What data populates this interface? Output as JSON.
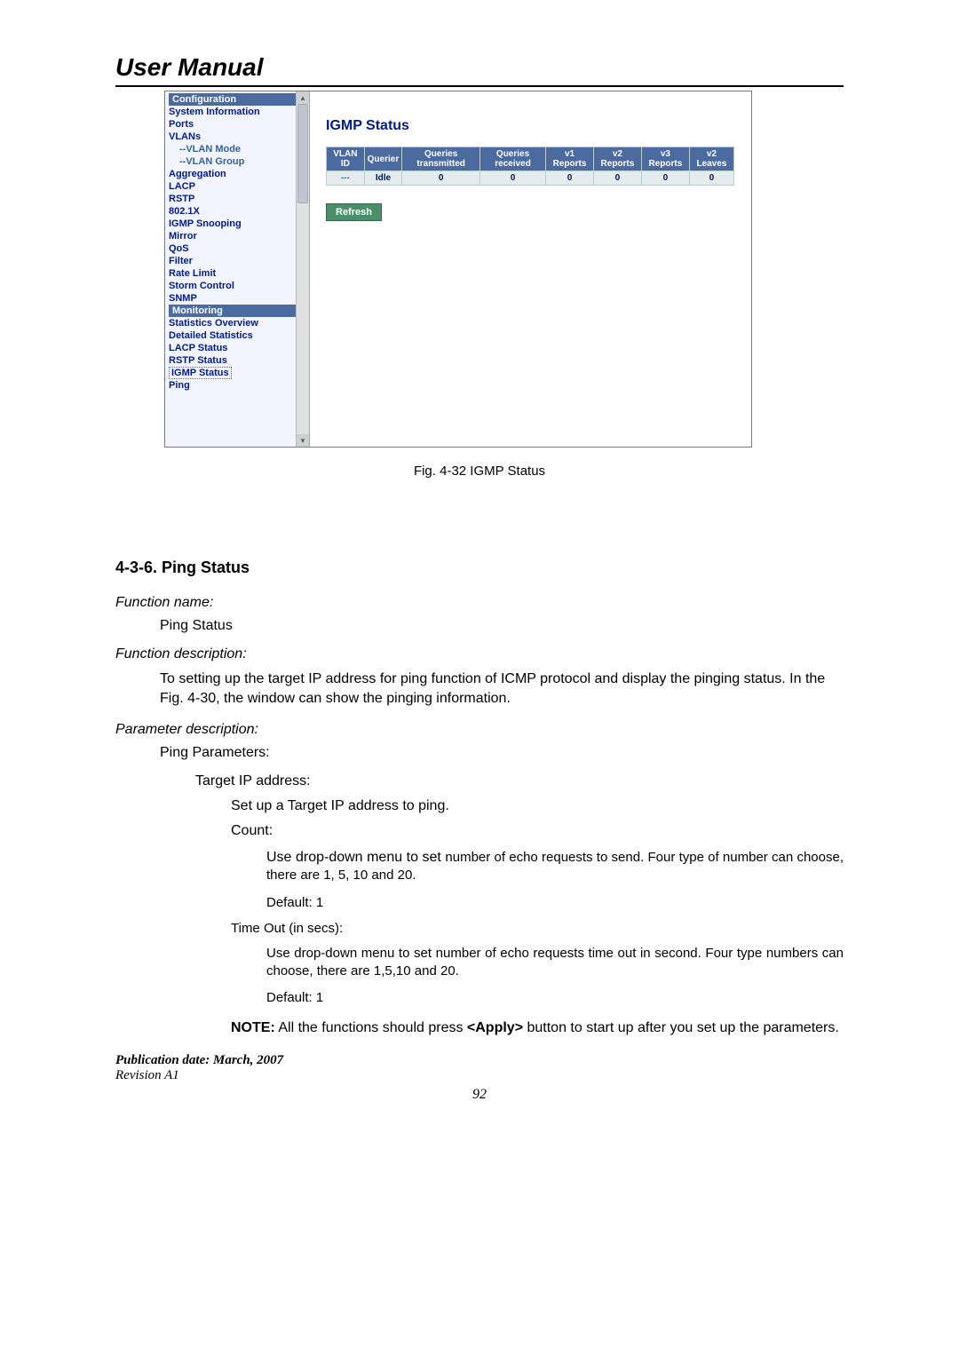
{
  "header": {
    "title": "User Manual"
  },
  "sidebar": {
    "sections": [
      {
        "type": "section",
        "label": "Configuration"
      },
      {
        "type": "item",
        "label": "System Information"
      },
      {
        "type": "item",
        "label": "Ports"
      },
      {
        "type": "item",
        "label": "VLANs"
      },
      {
        "type": "sub",
        "label": "--VLAN Mode"
      },
      {
        "type": "sub",
        "label": "--VLAN Group"
      },
      {
        "type": "item",
        "label": "Aggregation"
      },
      {
        "type": "item",
        "label": "LACP"
      },
      {
        "type": "item",
        "label": "RSTP"
      },
      {
        "type": "item",
        "label": "802.1X"
      },
      {
        "type": "item",
        "label": "IGMP Snooping"
      },
      {
        "type": "item",
        "label": "Mirror"
      },
      {
        "type": "item",
        "label": "QoS"
      },
      {
        "type": "item",
        "label": "Filter"
      },
      {
        "type": "item",
        "label": "Rate Limit"
      },
      {
        "type": "item",
        "label": "Storm Control"
      },
      {
        "type": "item",
        "label": "SNMP"
      },
      {
        "type": "section",
        "label": "Monitoring"
      },
      {
        "type": "item",
        "label": "Statistics Overview"
      },
      {
        "type": "item",
        "label": "Detailed Statistics"
      },
      {
        "type": "item",
        "label": "LACP Status"
      },
      {
        "type": "item",
        "label": "RSTP Status"
      },
      {
        "type": "item",
        "label": "IGMP Status",
        "current": true
      },
      {
        "type": "item",
        "label": "Ping"
      }
    ]
  },
  "content": {
    "title": "IGMP Status",
    "headers": [
      "VLAN ID",
      "Querier",
      "Queries transmitted",
      "Queries received",
      "v1 Reports",
      "v2 Reports",
      "v3 Reports",
      "v2 Leaves"
    ],
    "row": [
      "---",
      "Idle",
      "0",
      "0",
      "0",
      "0",
      "0",
      "0"
    ],
    "refresh": "Refresh"
  },
  "figure_caption": "Fig. 4-32 IGMP Status",
  "section_heading": "4-3-6. Ping Status",
  "fn_name_label": "Function name:",
  "fn_name_value": "Ping Status",
  "fn_desc_label": "Function description:",
  "fn_desc_value": "To setting up the target IP address for ping function of ICMP protocol and display the pinging status. In the Fig. 4-30, the window can show the pinging information.",
  "param_label": "Parameter description:",
  "ping_params": "Ping Parameters:",
  "target_ip_label": "Target IP address:",
  "target_ip_desc": "Set up a Target IP address to ping.",
  "count_label": "Count:",
  "count_desc1a": "Use drop-down menu to set ",
  "count_desc1b": "number of echo requests to send. Four type of number can choose, there are 1, 5, 10 and 20.",
  "count_default": "Default: 1",
  "timeout_label": "Time Out (in secs):",
  "timeout_desc": "Use drop-down menu to set number of echo requests time out in second. Four type numbers can choose, there are 1,5,10 and 20.",
  "timeout_default": "Default: 1",
  "note_label": "NOTE:",
  "note_text_a": " All the functions should press ",
  "note_apply": "<Apply>",
  "note_text_b": " button to start up after you set up the parameters.",
  "footer_pub": "Publication date: March, 2007",
  "footer_rev": "Revision A1",
  "page_number": "92"
}
